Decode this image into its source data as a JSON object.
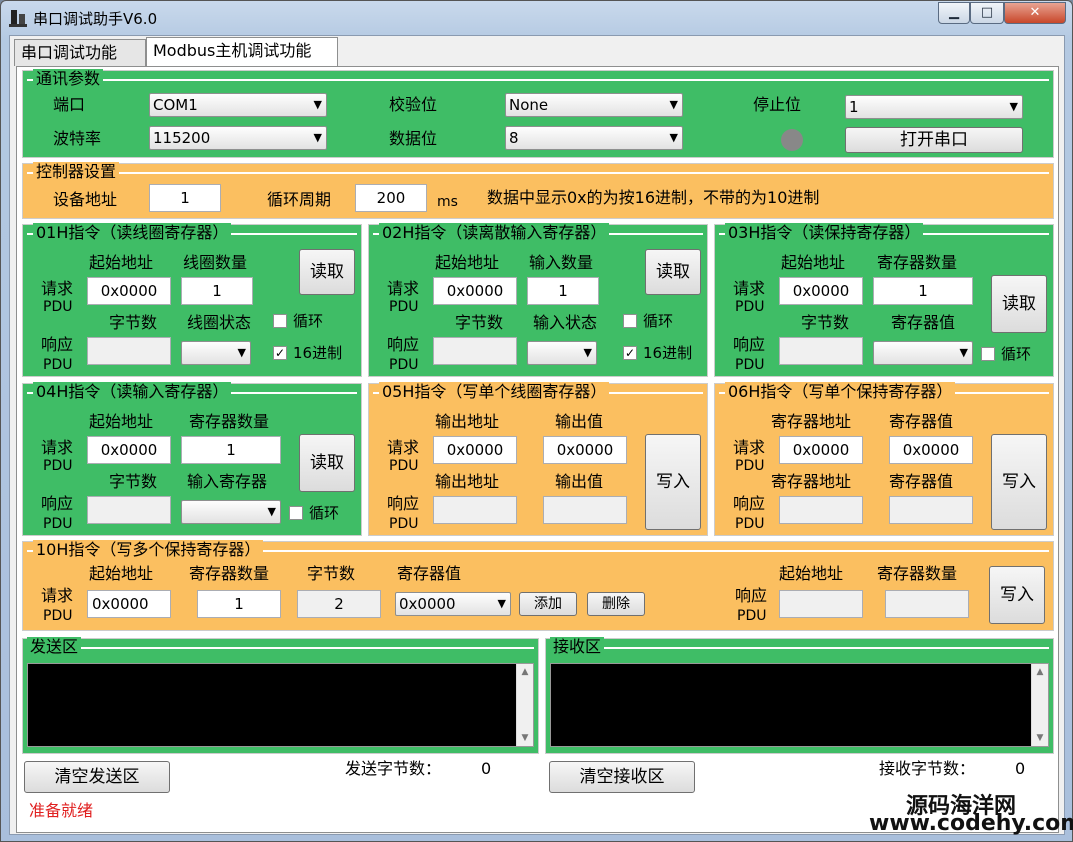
{
  "window": {
    "title": "串口调试助手V6.0",
    "min": "▁",
    "max": "□",
    "close": "✕"
  },
  "tabs": [
    {
      "label": "串口调试功能"
    },
    {
      "label": "Modbus主机调试功能"
    }
  ],
  "comm": {
    "title": "通讯参数",
    "port_label": "端口",
    "port_value": "COM1",
    "baud_label": "波特率",
    "baud_value": "115200",
    "parity_label": "校验位",
    "parity_value": "None",
    "databits_label": "数据位",
    "databits_value": "8",
    "stopbits_label": "停止位",
    "stopbits_value": "1",
    "open_button": "打开串口"
  },
  "ctrl": {
    "title": "控制器设置",
    "addr_label": "设备地址",
    "addr_value": "1",
    "cycle_label": "循环周期",
    "cycle_value": "200",
    "cycle_unit": "ms",
    "hint": "数据中显示0x的为按16进制，不带的为10进制"
  },
  "common": {
    "req": "请求",
    "resp": "响应",
    "pdu": "PDU",
    "read": "读取",
    "write": "写入",
    "loop": "循环",
    "hex": "16进制",
    "bytes": "字节数"
  },
  "f01": {
    "title": "01H指令（读线圈寄存器）",
    "start_label": "起始地址",
    "start_value": "0x0000",
    "qty_label": "线圈数量",
    "qty_value": "1",
    "state_label": "线圈状态"
  },
  "f02": {
    "title": "02H指令（读离散输入寄存器）",
    "start_label": "起始地址",
    "start_value": "0x0000",
    "qty_label": "输入数量",
    "qty_value": "1",
    "state_label": "输入状态"
  },
  "f03": {
    "title": "03H指令（读保持寄存器）",
    "start_label": "起始地址",
    "start_value": "0x0000",
    "qty_label": "寄存器数量",
    "qty_value": "1",
    "state_label": "寄存器值"
  },
  "f04": {
    "title": "04H指令（读输入寄存器）",
    "start_label": "起始地址",
    "start_value": "0x0000",
    "qty_label": "寄存器数量",
    "qty_value": "1",
    "state_label": "输入寄存器"
  },
  "f05": {
    "title": "05H指令（写单个线圈寄存器）",
    "addr_label": "输出地址",
    "addr_value": "0x0000",
    "val_label": "输出值",
    "val_value": "0x0000"
  },
  "f06": {
    "title": "06H指令（写单个保持寄存器）",
    "addr_label": "寄存器地址",
    "addr_value": "0x0000",
    "val_label": "寄存器值",
    "val_value": "0x0000"
  },
  "f10": {
    "title": "10H指令（写多个保持寄存器）",
    "start_label": "起始地址",
    "start_value": "0x0000",
    "qty_label": "寄存器数量",
    "qty_value": "1",
    "bytes_label": "字节数",
    "bytes_value": "2",
    "regval_label": "寄存器值",
    "regval_value": "0x0000",
    "add_button": "添加",
    "del_button": "删除",
    "resp_start_label": "起始地址",
    "resp_qty_label": "寄存器数量"
  },
  "send": {
    "title": "发送区",
    "clear_button": "清空发送区",
    "count_label": "发送字节数：",
    "count_value": "0"
  },
  "recv": {
    "title": "接收区",
    "clear_button": "清空接收区",
    "count_label": "接收字节数：",
    "count_value": "0"
  },
  "status": {
    "text": "准备就绪"
  },
  "watermark": {
    "line1": "源码海洋网",
    "line2": "www.codehy.com"
  }
}
